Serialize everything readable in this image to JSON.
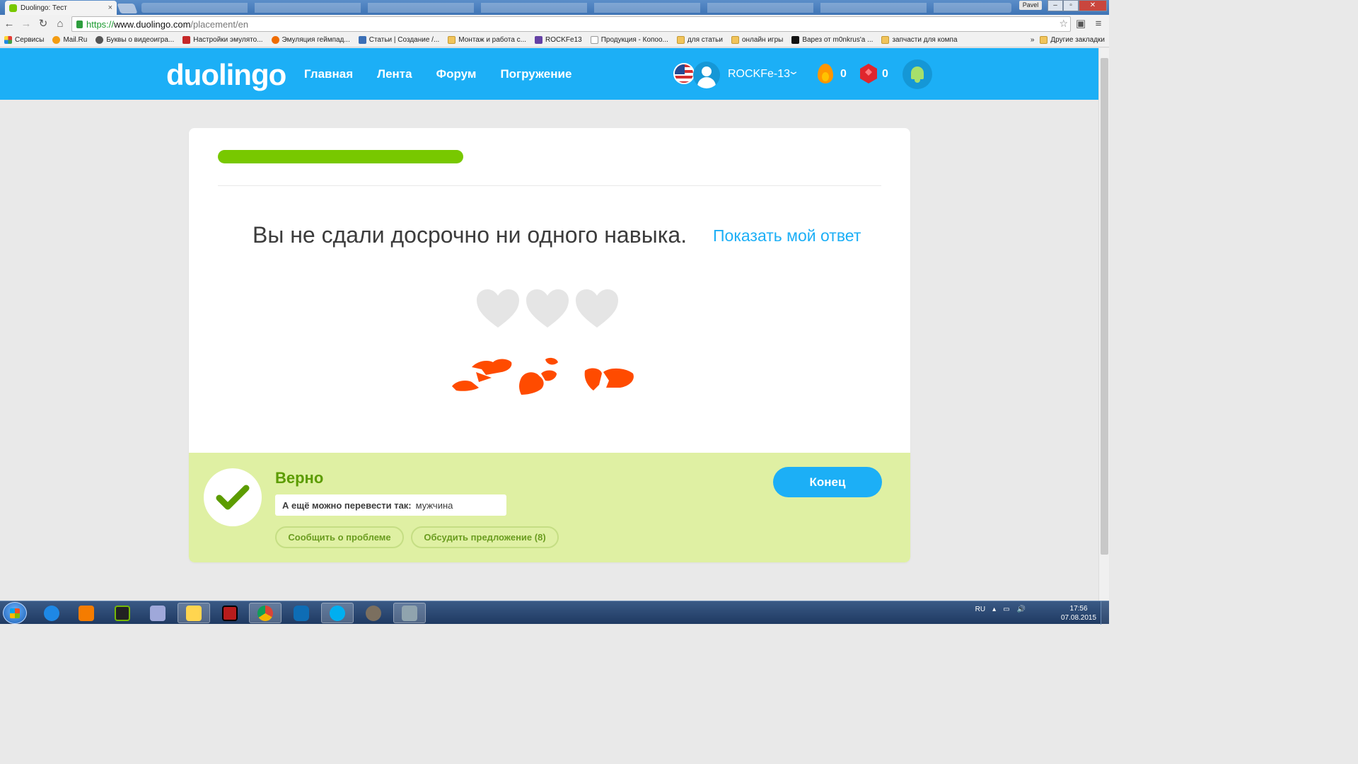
{
  "browser": {
    "tab_title": "Duolingo: Тест",
    "tab_close": "×",
    "profile_name": "Pavel",
    "url_scheme": "https://",
    "url_host": "www.duolingo.com",
    "url_path": "/placement/en",
    "bookmarks": [
      {
        "label": "Сервисы",
        "icon": "apps-icon"
      },
      {
        "label": "Mail.Ru",
        "icon": "mailru-icon"
      },
      {
        "label": "Буквы о видеоигра...",
        "icon": "user-icon"
      },
      {
        "label": "Настройки эмулято...",
        "icon": "red-icon"
      },
      {
        "label": "Эмуляция геймпад...",
        "icon": "orange-icon"
      },
      {
        "label": "Статьи | Создание /...",
        "icon": "b-icon"
      },
      {
        "label": "Монтаж и работа с...",
        "icon": "folder-icon"
      },
      {
        "label": "ROCKFe13",
        "icon": "twitch-icon"
      },
      {
        "label": "Продукция - Копоо...",
        "icon": "page-icon"
      },
      {
        "label": "для статьи",
        "icon": "folder-icon"
      },
      {
        "label": "онлайн игры",
        "icon": "folder-icon"
      },
      {
        "label": "Варез от m0nkrus'a ...",
        "icon": "m-icon"
      },
      {
        "label": "запчасти для компа",
        "icon": "folder-icon"
      }
    ],
    "bookmarks_more": "»",
    "other_bookmarks": "Другие закладки"
  },
  "header": {
    "logo": "duolingo",
    "nav": [
      "Главная",
      "Лента",
      "Форум",
      "Погружение"
    ],
    "username": "ROCKFe-13",
    "streak": "0",
    "lingots": "0"
  },
  "lesson": {
    "progress_fraction": 0.37,
    "result_text": "Вы не сдали досрочно ни одного навыка.",
    "show_answer": "Показать мой ответ",
    "hearts_remaining": 0,
    "hearts_total": 3
  },
  "footer": {
    "verdict": "Верно",
    "alt_label": "А ещё можно перевести так:",
    "alt_value": "мужчина",
    "report_button": "Сообщить о проблеме",
    "discuss_button": "Обсудить предложение (8)",
    "finish_button": "Конец"
  },
  "colors": {
    "brand_blue": "#1caff6",
    "progress_green": "#78c800",
    "correct_bg": "#dff0a3",
    "correct_text": "#5c9c00",
    "broken_heart": "#ff4b00"
  },
  "taskbar": {
    "apps": [
      "ie-icon",
      "media-player-icon",
      "nvidia-icon",
      "paint-icon",
      "explorer-icon",
      "terminal-icon",
      "chrome-icon",
      "teamviewer-icon",
      "skype-icon",
      "gimp-icon",
      "archive-icon"
    ],
    "language": "RU",
    "time": "17:56",
    "date": "07.08.2015"
  }
}
